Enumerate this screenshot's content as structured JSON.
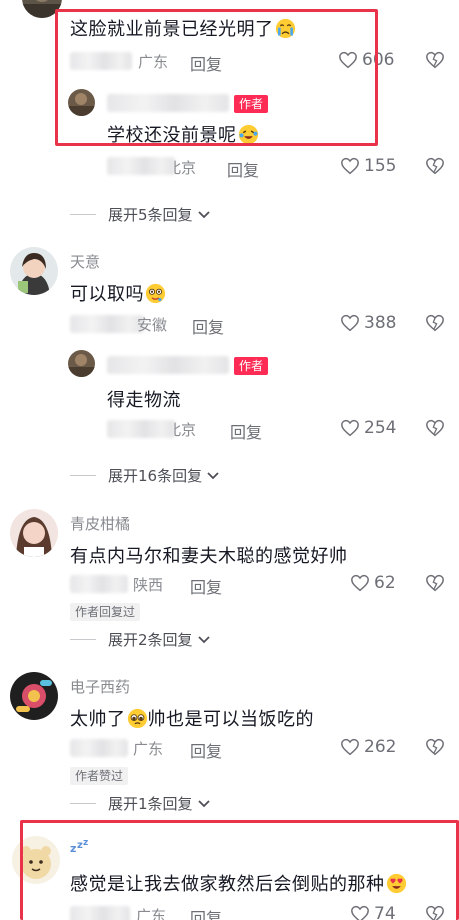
{
  "comments": [
    {
      "text": "这脸就业前景已经光明了",
      "location": "广东",
      "reply_label": "回复",
      "likes": "606",
      "reply": {
        "author_tag": "作者",
        "text": "学校还没前景呢",
        "location": "北京",
        "reply_label": "回复",
        "likes": "155"
      },
      "expand_label": "展开5条回复"
    },
    {
      "username": "天意",
      "text": "可以取吗",
      "location": "安徽",
      "reply_label": "回复",
      "likes": "388",
      "reply": {
        "author_tag": "作者",
        "text": "得走物流",
        "location": "北京",
        "reply_label": "回复",
        "likes": "254"
      },
      "expand_label": "展开16条回复"
    },
    {
      "username": "青皮柑橘",
      "text": "有点内马尔和妻夫木聪的感觉好帅",
      "location": "陕西",
      "reply_label": "回复",
      "likes": "62",
      "badge": "作者回复过",
      "expand_label": "展开2条回复"
    },
    {
      "username": "电子西药",
      "text_before": "太帅了",
      "text_after": "帅也是可以当饭吃的",
      "location": "广东",
      "reply_label": "回复",
      "likes": "262",
      "badge": "作者赞过",
      "expand_label": "展开1条回复"
    },
    {
      "username_icon": "zzz",
      "text": "感觉是让我去做家教然后会倒贴的那种",
      "location": "广东",
      "reply_label": "回复",
      "likes": "74"
    }
  ],
  "colors": {
    "author_tag": "#fe2c55",
    "highlight_box": "#e8334a",
    "meta_text": "#8a8b91"
  },
  "icons": [
    "heart-outline-icon",
    "broken-heart-icon",
    "chevron-down-icon",
    "crying-emoji",
    "laughing-crying-emoji",
    "drooling-emoji",
    "tearful-emoji",
    "heart-eyes-emoji",
    "zzz-icon"
  ]
}
